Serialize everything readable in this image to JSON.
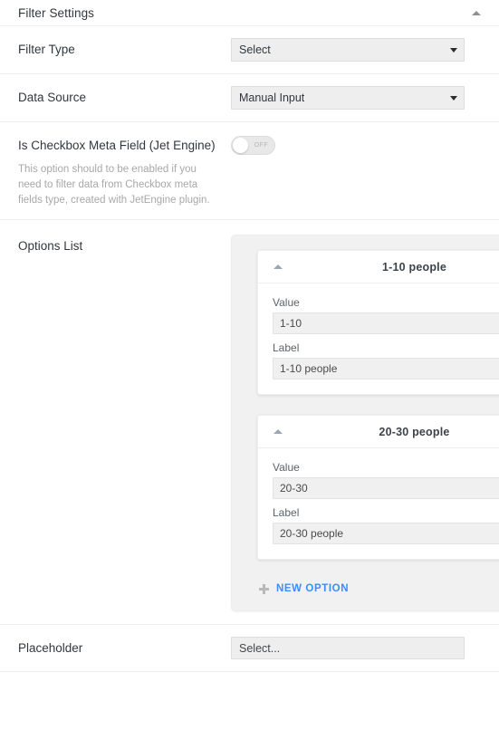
{
  "panel": {
    "title": "Filter Settings",
    "collapse_icon": "triangle-up-icon"
  },
  "rows": {
    "filter_type": {
      "label": "Filter Type",
      "value": "Select",
      "caret_icon": "chevron-down-icon"
    },
    "data_source": {
      "label": "Data Source",
      "value": "Manual Input",
      "caret_icon": "chevron-down-icon"
    },
    "checkbox_meta": {
      "label": "Is Checkbox Meta Field (Jet Engine)",
      "toggle_state": "OFF",
      "description": "This option should to be enabled if you need to filter data from Checkbox meta fields type, created with JetEngine plugin."
    },
    "options_list": {
      "label": "Options List",
      "new_option_label": "NEW OPTION",
      "plus_icon": "plus-icon",
      "options": [
        {
          "title": "1-10 people",
          "collapse_icon": "triangle-up-icon",
          "remove_icon": "close-icon",
          "value_label": "Value",
          "value": "1-10",
          "label_label": "Label",
          "label_value": "1-10 people"
        },
        {
          "title": "20-30 people",
          "collapse_icon": "triangle-up-icon",
          "remove_icon": "close-icon",
          "value_label": "Value",
          "value": "20-30",
          "label_label": "Label",
          "label_value": "20-30 people"
        }
      ]
    },
    "placeholder": {
      "label": "Placeholder",
      "value": "Select..."
    }
  },
  "colors": {
    "accent_link": "#3a8dff",
    "text_primary": "#32373c",
    "text_muted": "#a8a8a8",
    "input_bg": "#eeeeee",
    "repeater_bg": "#f1f1f1"
  },
  "icons": {
    "close_glyph": "✖"
  }
}
